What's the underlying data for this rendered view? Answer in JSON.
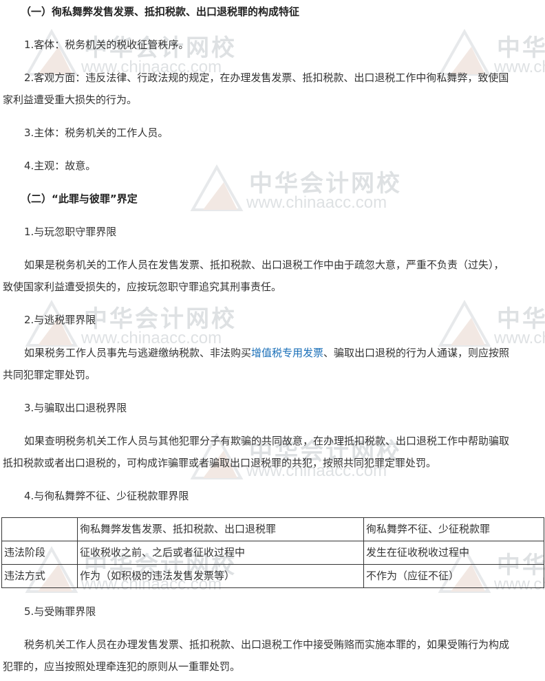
{
  "watermark": {
    "cn": "中华会计网校",
    "url": "www.chinaacc.com"
  },
  "section1": {
    "heading": "（一）徇私舞弊发售发票、抵扣税款、出口退税罪的构成特征",
    "p1": "1.客体：税务机关的税收征管秩序。",
    "p2a": "2.客观方面：违反法律、行政法规的规定，在办理发售发票、抵扣税款、出口退税工作中徇私舞弊，致使国",
    "p2b": "家利益遭受重大损失的行为。",
    "p3": "3.主体：税务机关的工作人员。",
    "p4": "4.主观：故意。"
  },
  "section2": {
    "heading": "（二）“此罪与彼罪”界定",
    "s1_title": "1.与玩忽职守罪界限",
    "s1_a": "如果是税务机关的工作人员在发售发票、抵扣税款、出口退税工作中由于疏忽大意，严重不负责（过失），",
    "s1_b": "致使国家利益遭受损失的，应按玩忽职守罪追究其刑事责任。",
    "s2_title": "2.与逃税罪界限",
    "s2_a1": "如果税务工作人员事先与逃避缴纳税款、非法购买",
    "s2_link": "增值税专用发票",
    "s2_a2": "、骗取出口退税的行为人通谋，则应按照",
    "s2_b": "共同犯罪定罪处罚。",
    "s3_title": "3.与骗取出口退税界限",
    "s3_a": "如果查明税务机关工作人员与其他犯罪分子有欺骗的共同故意，在办理抵扣税款、出口退税工作中帮助骗取",
    "s3_b": "抵扣税款或者出口退税的，可构成诈骗罪或者骗取出口退税罪的共犯，按照共同犯罪定罪处罚。",
    "s4_title": "4.与徇私舞弊不征、少征税款罪界限",
    "table": {
      "header": [
        "",
        "徇私舞弊发售发票、抵扣税款、出口退税罪",
        "徇私舞弊不征、少征税款罪"
      ],
      "rows": [
        [
          "违法阶段",
          "征收税收之前、之后或者征收过程中",
          "发生在征收税收过程中"
        ],
        [
          "违法方式",
          "作为（如积极的违法发售发票等）",
          "不作为（应征不征）"
        ]
      ]
    },
    "s5_title": "5.与受贿罪界限",
    "s5_a": "税务机关工作人员在办理发售发票、抵扣税款、出口退税工作中接受贿赂而实施本罪的，如果受贿行为构成",
    "s5_b": "犯罪的，应当按照处理牵连犯的原则从一重罪处罚。"
  }
}
